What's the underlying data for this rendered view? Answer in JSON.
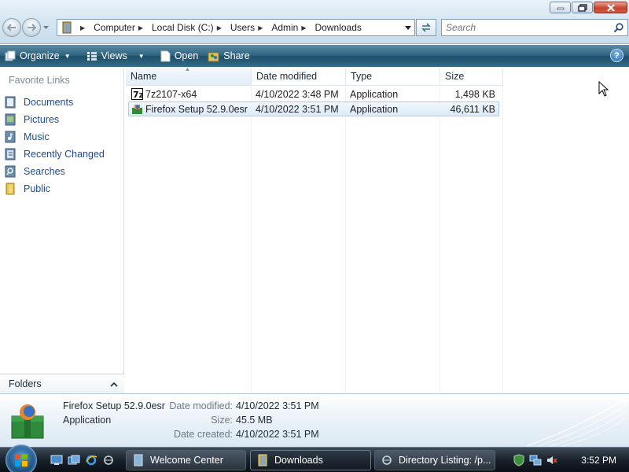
{
  "window": {
    "controls": [
      "minimize",
      "maximize",
      "close"
    ]
  },
  "address": {
    "crumbs": [
      "Computer",
      "Local Disk (C:)",
      "Users",
      "Admin",
      "Downloads"
    ]
  },
  "search": {
    "placeholder": "Search"
  },
  "toolbar": {
    "organize": "Organize",
    "views": "Views",
    "open": "Open",
    "share": "Share",
    "help": "?"
  },
  "sidebar": {
    "heading": "Favorite Links",
    "items": [
      {
        "label": "Documents",
        "icon": "documents-icon"
      },
      {
        "label": "Pictures",
        "icon": "pictures-icon"
      },
      {
        "label": "Music",
        "icon": "music-icon"
      },
      {
        "label": "Recently Changed",
        "icon": "recently-changed-icon"
      },
      {
        "label": "Searches",
        "icon": "searches-icon"
      },
      {
        "label": "Public",
        "icon": "public-folder-icon"
      }
    ],
    "folders_label": "Folders"
  },
  "columns": {
    "name": "Name",
    "date": "Date modified",
    "type": "Type",
    "size": "Size"
  },
  "files": [
    {
      "name": "7z2107-x64",
      "date": "4/10/2022 3:48 PM",
      "type": "Application",
      "size": "1,498 KB",
      "icon": "7zip-icon",
      "selected": false
    },
    {
      "name": "Firefox Setup 52.9.0esr",
      "date": "4/10/2022 3:51 PM",
      "type": "Application",
      "size": "46,611 KB",
      "icon": "firefox-installer-icon",
      "selected": true
    }
  ],
  "details": {
    "name": "Firefox Setup 52.9.0esr",
    "type": "Application",
    "modified_label": "Date modified:",
    "modified": "4/10/2022 3:51 PM",
    "size_label": "Size:",
    "size": "45.5 MB",
    "created_label": "Date created:",
    "created": "4/10/2022 3:51 PM"
  },
  "taskbar": {
    "buttons": [
      {
        "label": "Welcome Center",
        "active": false
      },
      {
        "label": "Downloads",
        "active": true
      },
      {
        "label": "Directory Listing: /p...",
        "active": false
      }
    ],
    "clock": "3:52 PM"
  },
  "colors": {
    "link": "#1a4d92",
    "toolbar": "#2e6480",
    "selection": "#dcebf9",
    "taskbar": "#1a222b"
  }
}
